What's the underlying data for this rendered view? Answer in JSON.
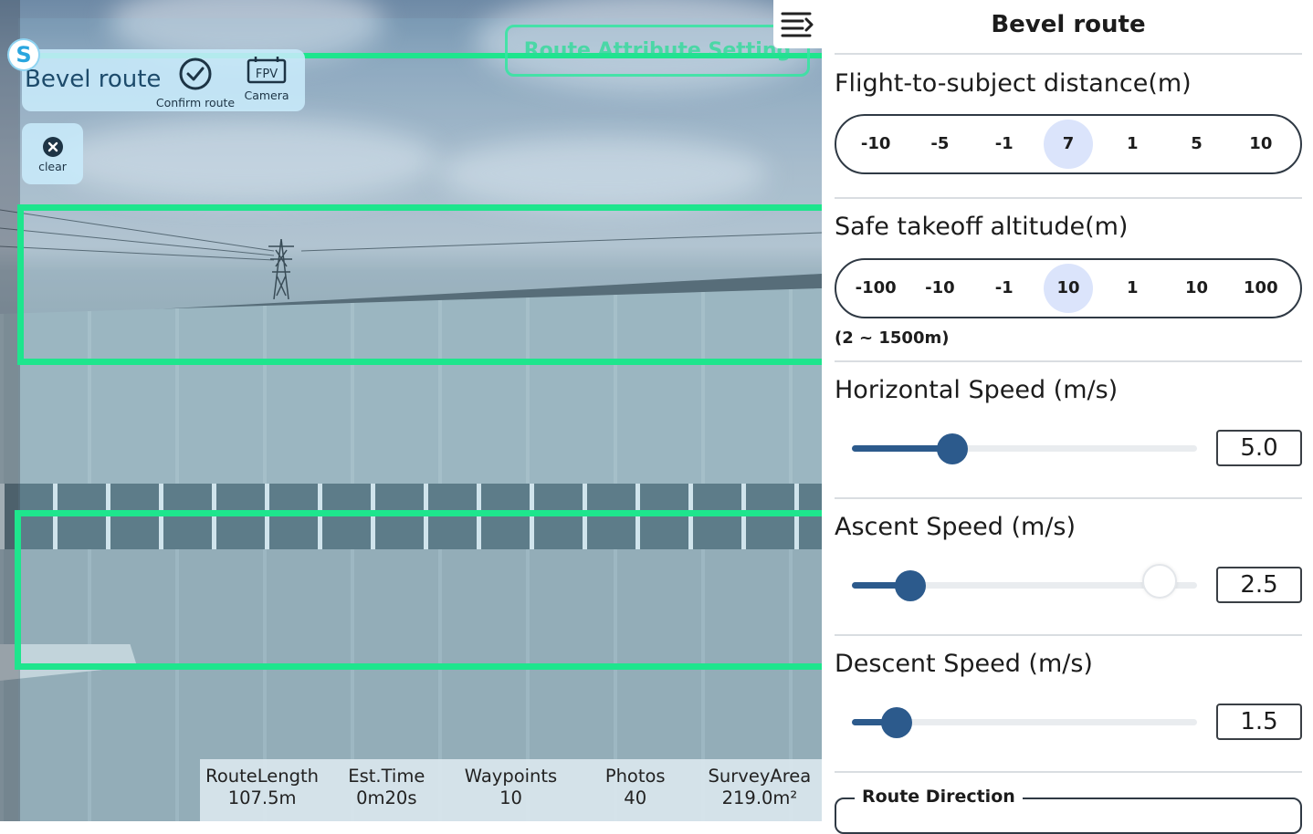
{
  "camera": {
    "top_button": "Route Attribute Setting",
    "logo": "S",
    "route_card": {
      "title": "Bevel route",
      "confirm_label": "Confirm route",
      "fpv_badge": "FPV",
      "camera_label": "Camera"
    },
    "clear_label": "clear",
    "stats": [
      {
        "label": "RouteLength",
        "value": "107.5m"
      },
      {
        "label": "Est.Time",
        "value": "0m20s"
      },
      {
        "label": "Waypoints",
        "value": "10"
      },
      {
        "label": "Photos",
        "value": "40"
      },
      {
        "label": "SurveyArea",
        "value": "219.0m²"
      }
    ]
  },
  "panel": {
    "title": "Bevel route",
    "distance": {
      "label": "Flight-to-subject distance(m)",
      "options": [
        "-10",
        "-5",
        "-1",
        "7",
        "1",
        "5",
        "10"
      ],
      "current": "7"
    },
    "takeoff": {
      "label": "Safe takeoff altitude(m)",
      "options": [
        "-100",
        "-10",
        "-1",
        "10",
        "1",
        "10",
        "100"
      ],
      "current": "10",
      "range_hint": "(2 ~ 1500m)"
    },
    "horizontal_speed": {
      "label": "Horizontal Speed (m/s)",
      "value": "5.0",
      "fraction": 0.29
    },
    "ascent_speed": {
      "label": "Ascent Speed (m/s)",
      "value": "2.5",
      "fraction": 0.17
    },
    "descent_speed": {
      "label": "Descent Speed (m/s)",
      "value": "1.5",
      "fraction": 0.13
    },
    "route_direction": {
      "label": "Route Direction"
    }
  },
  "colors": {
    "accent": "#1ee58d",
    "slider": "#2c5a8c",
    "active_option": "#dbe4fb"
  }
}
